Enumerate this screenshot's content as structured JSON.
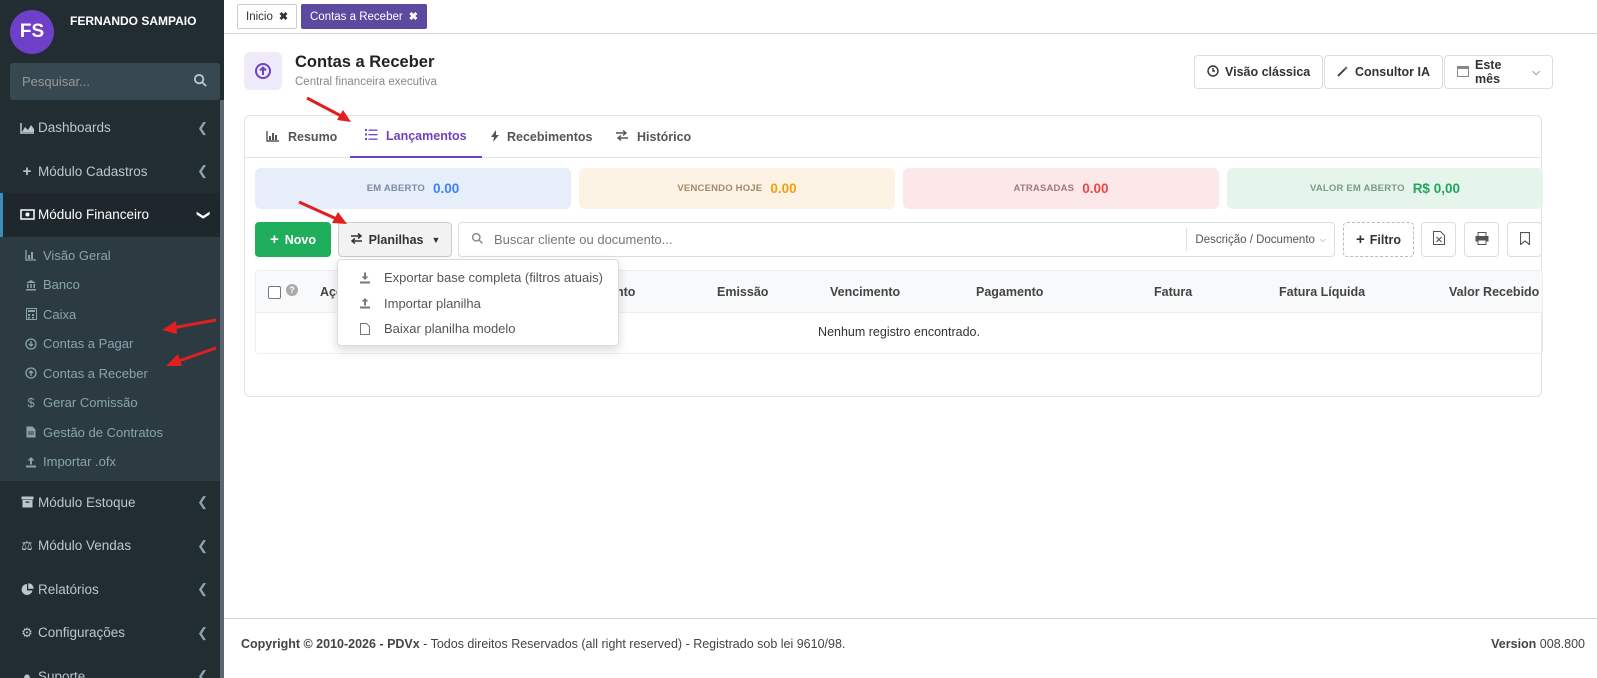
{
  "user": {
    "initials": "FS",
    "name": "FERNANDO SAMPAIO"
  },
  "sidebar": {
    "search_placeholder": "Pesquisar...",
    "items": [
      {
        "label": "Dashboards",
        "icon": "area-chart-icon"
      },
      {
        "label": "Módulo Cadastros",
        "icon": "plus-icon"
      },
      {
        "label": "Módulo Financeiro",
        "icon": "money-icon"
      },
      {
        "label": "Módulo Estoque",
        "icon": "archive-icon"
      },
      {
        "label": "Módulo Vendas",
        "icon": "balance-scale-icon"
      },
      {
        "label": "Relatórios",
        "icon": "pie-chart-icon"
      },
      {
        "label": "Configurações",
        "icon": "gears-icon"
      },
      {
        "label": "Suporte",
        "icon": "support-icon"
      }
    ],
    "financeiro_sub": [
      {
        "label": "Visão Geral",
        "icon": "chart-icon"
      },
      {
        "label": "Banco",
        "icon": "bank-icon"
      },
      {
        "label": "Caixa",
        "icon": "calculator-icon"
      },
      {
        "label": "Contas a Pagar",
        "icon": "arrow-circle-down-icon"
      },
      {
        "label": "Contas a Receber",
        "icon": "arrow-circle-up-icon"
      },
      {
        "label": "Gerar Comissão",
        "icon": "dollar-icon"
      },
      {
        "label": "Gestão de Contratos",
        "icon": "file-icon"
      },
      {
        "label": "Importar .ofx",
        "icon": "upload-icon"
      }
    ]
  },
  "top_tabs": [
    {
      "label": "Inicio"
    },
    {
      "label": "Contas a Receber"
    }
  ],
  "header": {
    "title": "Contas a Receber",
    "subtitle": "Central financeira executiva",
    "btn_classic": "Visão clássica",
    "btn_ai": "Consultor IA",
    "btn_period": "Este mês"
  },
  "tabs": [
    {
      "label": "Resumo"
    },
    {
      "label": "Lançamentos"
    },
    {
      "label": "Recebimentos"
    },
    {
      "label": "Histórico"
    }
  ],
  "kpis": [
    {
      "label": "EM ABERTO",
      "value": "0.00",
      "bg": "#e6eefa",
      "label_color": "#7a8aa0",
      "value_color": "#3b82f6"
    },
    {
      "label": "VENCENDO HOJE",
      "value": "0.00",
      "bg": "#fdf3e4",
      "label_color": "#a08a6a",
      "value_color": "#f59e0b"
    },
    {
      "label": "ATRASADAS",
      "value": "0.00",
      "bg": "#fce8e8",
      "label_color": "#a07a7a",
      "value_color": "#ef4444"
    },
    {
      "label": "VALOR EM ABERTO",
      "value": "R$ 0,00",
      "bg": "#e6f5ec",
      "label_color": "#7a9a85",
      "value_color": "#22a55a"
    }
  ],
  "toolbar": {
    "novo": "Novo",
    "planilhas": "Planilhas",
    "search_placeholder": "Buscar cliente ou documento...",
    "search_field": "Descrição / Documento",
    "filtro": "Filtro"
  },
  "dropdown": [
    {
      "label": "Exportar base completa (filtros atuais)",
      "icon": "download-icon"
    },
    {
      "label": "Importar planilha",
      "icon": "upload-icon"
    },
    {
      "label": "Baixar planilha modelo",
      "icon": "file-icon"
    }
  ],
  "table": {
    "columns": [
      "Açõ",
      "nto",
      "Emissão",
      "Vencimento",
      "Pagamento",
      "Fatura",
      "Fatura Líquida",
      "Valor Recebido"
    ],
    "empty": "Nenhum registro encontrado."
  },
  "footer": {
    "copyright_bold": "Copyright © 2010-2026 - PDVx",
    "copyright_rest": " - Todos direitos Reservados (all right reserved) - Registrado sob lei 9610/98.",
    "version_label": "Version",
    "version_value": " 008.800"
  },
  "colors": {
    "accent": "#6f42c1",
    "sidebar": "#222d32",
    "arrow": "#e02020"
  }
}
